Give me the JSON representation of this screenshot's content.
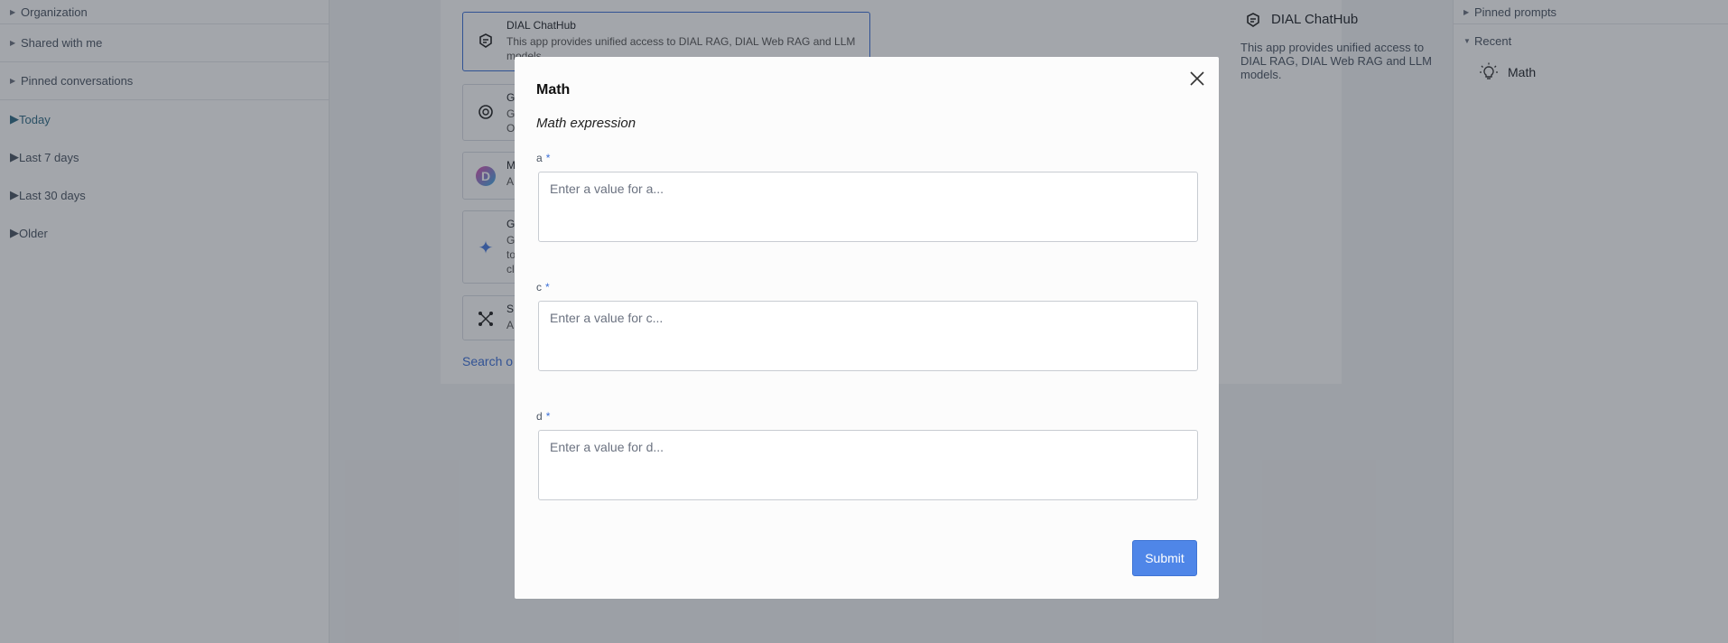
{
  "left_sidebar": {
    "sections": [
      {
        "label": "Organization"
      },
      {
        "label": "Shared with me"
      },
      {
        "label": "Pinned conversations"
      }
    ],
    "groups": [
      {
        "label": "Today",
        "active": true
      },
      {
        "label": "Last 7 days"
      },
      {
        "label": "Last 30 days"
      },
      {
        "label": "Older"
      }
    ]
  },
  "center": {
    "models": [
      {
        "name": "DIAL ChatHub",
        "description": "This app provides unified access to DIAL RAG, DIAL Web RAG and LLM models.",
        "icon": "chathub-icon",
        "selected": true
      },
      {
        "name": "G",
        "description": "G O",
        "icon": "openai-icon"
      },
      {
        "name": "M",
        "description": "A",
        "icon": "d-logo-icon"
      },
      {
        "name": "G",
        "description": "G to cl",
        "icon": "sparkle-icon"
      },
      {
        "name": "S",
        "description": "A",
        "icon": "network-icon"
      }
    ],
    "search_link": "Search o",
    "detail": {
      "title": "DIAL ChatHub",
      "description": "This app provides unified access to DIAL RAG, DIAL Web RAG and LLM models."
    }
  },
  "right_sidebar": {
    "pinned_label": "Pinned prompts",
    "recent_label": "Recent",
    "recent_items": [
      {
        "label": "Math",
        "icon": "lightbulb-icon"
      }
    ]
  },
  "modal": {
    "title": "Math",
    "subtitle": "Math expression",
    "required_mark": "*",
    "fields": [
      {
        "label": "a",
        "placeholder": "Enter a value for a..."
      },
      {
        "label": "c",
        "placeholder": "Enter a value for c..."
      },
      {
        "label": "d",
        "placeholder": "Enter a value for d..."
      }
    ],
    "submit_label": "Submit"
  },
  "colors": {
    "accent": "#4f86e8",
    "link": "#3b6fd8",
    "active_group": "#2f6b86",
    "overlay": "rgba(35,42,54,0.42)"
  }
}
